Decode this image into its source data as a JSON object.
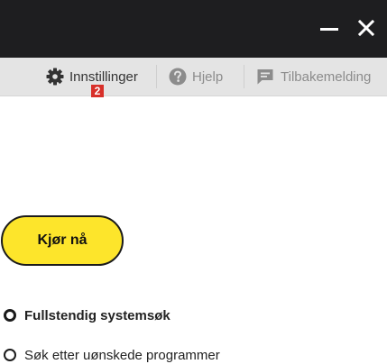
{
  "titlebar": {
    "minimize_icon": "minimize-icon",
    "close_icon": "close-icon",
    "background": "#1e1e20"
  },
  "toolbar": {
    "settings": {
      "label": "Innstillinger",
      "icon": "gear-icon"
    },
    "help": {
      "label": "Hjelp",
      "icon": "question-circle-icon"
    },
    "feedback": {
      "label": "Tilbakemelding",
      "icon": "chat-bubble-icon"
    }
  },
  "annotation": {
    "step_number": "2",
    "color": "#d8302a"
  },
  "main": {
    "run_button_label": "Kjør nå",
    "run_button_color": "#fde52b",
    "scan_options": [
      {
        "label": "Fullstendig systemsøk",
        "selected": true
      },
      {
        "label": "Søk etter uønskede programmer",
        "selected": false
      }
    ]
  }
}
